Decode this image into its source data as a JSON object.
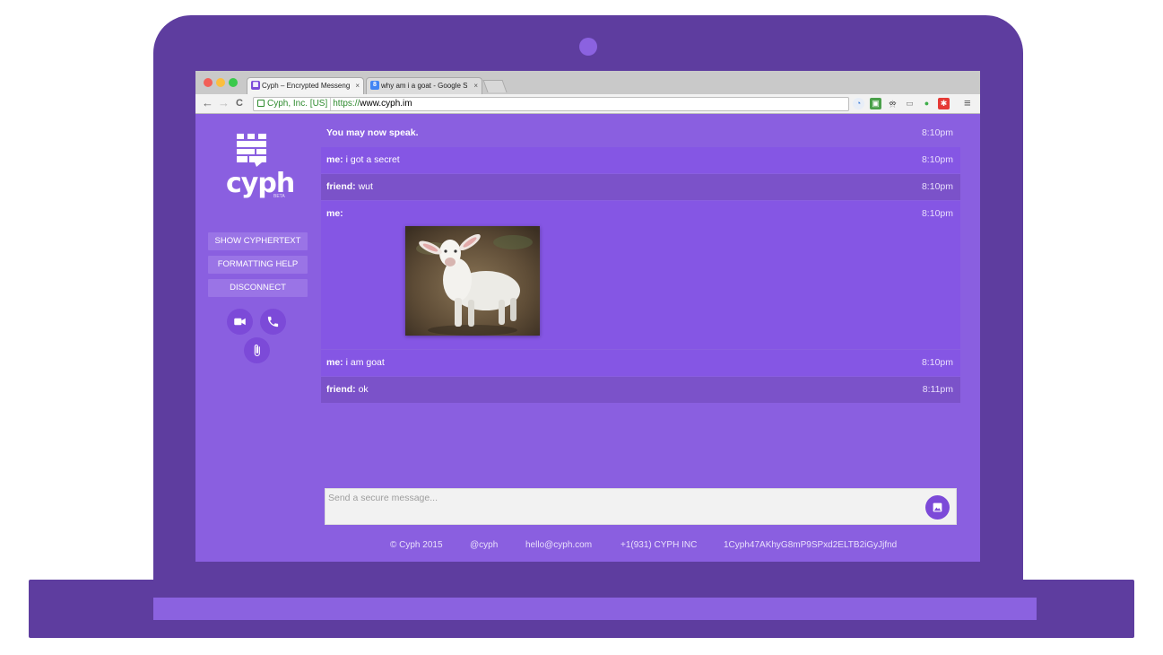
{
  "colors": {
    "frame": "#5e3d9f",
    "app_background": "#8a5fe0",
    "my_message": "#8556e4",
    "friend_message": "#7b52c9",
    "button": "#7c4ad8"
  },
  "browser": {
    "tabs": [
      {
        "title": "Cyph – Encrypted Messeng",
        "favicon": "cyph-favicon-icon",
        "close": "×"
      },
      {
        "title": "why am i a goat - Google S",
        "favicon": "google-favicon-icon",
        "close": "×"
      }
    ],
    "back": "←",
    "forward": "→",
    "reload": "C",
    "certificate_owner": "Cyph, Inc. [US]",
    "url_protocol": "https://",
    "url_host": "www.cyph.im",
    "menu": "≡"
  },
  "app": {
    "logo_text": "cyph",
    "logo_badge": "BETA",
    "sidebar_buttons": {
      "cyphertext": "SHOW CYPHERTEXT",
      "formatting": "FORMATTING HELP",
      "disconnect": "DISCONNECT"
    },
    "messages": [
      {
        "type": "plain",
        "author": "",
        "text": "You may now speak.",
        "time": "8:10pm"
      },
      {
        "type": "mine",
        "author": "me:",
        "text": " i got a secret",
        "time": "8:10pm"
      },
      {
        "type": "friend",
        "author": "friend:",
        "text": " wut",
        "time": "8:10pm"
      },
      {
        "type": "image",
        "author": "me:",
        "text": "",
        "time": "8:10pm"
      },
      {
        "type": "mine",
        "author": "me:",
        "text": " i am goat",
        "time": "8:10pm"
      },
      {
        "type": "friend",
        "author": "friend:",
        "text": " ok",
        "time": "8:11pm"
      }
    ],
    "composer": {
      "placeholder": "Send a secure message..."
    },
    "footer": {
      "copyright": "© Cyph 2015",
      "twitter": "@cyph",
      "email": "hello@cyph.com",
      "phone": "+1(931) CYPH INC",
      "bitcoin": "1Cyph47AKhyG8mP9SPxd2ELTB2iGyJjfnd"
    }
  }
}
